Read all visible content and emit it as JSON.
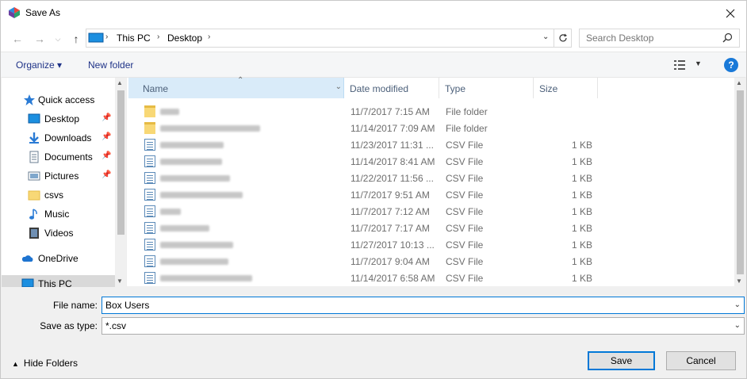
{
  "window": {
    "title": "Save As"
  },
  "address": {
    "crumbs": [
      "This PC",
      "Desktop"
    ]
  },
  "search": {
    "placeholder": "Search Desktop"
  },
  "toolbar": {
    "organize": "Organize ▾",
    "new_folder": "New folder",
    "help": "?"
  },
  "nav": {
    "items": [
      {
        "label": "Quick access",
        "icon": "star-icon"
      },
      {
        "label": "Desktop",
        "icon": "desktop-icon",
        "pinned": true
      },
      {
        "label": "Downloads",
        "icon": "download-icon",
        "pinned": true
      },
      {
        "label": "Documents",
        "icon": "documents-icon",
        "pinned": true
      },
      {
        "label": "Pictures",
        "icon": "pictures-icon",
        "pinned": true
      },
      {
        "label": "csvs",
        "icon": "folder-icon"
      },
      {
        "label": "Music",
        "icon": "music-icon"
      },
      {
        "label": "Videos",
        "icon": "video-icon"
      },
      {
        "label": "OneDrive",
        "icon": "cloud-icon"
      },
      {
        "label": "This PC",
        "icon": "pc-icon",
        "selected": true
      }
    ]
  },
  "columns": {
    "name": "Name",
    "date": "Date modified",
    "type": "Type",
    "size": "Size"
  },
  "files": [
    {
      "date": "11/7/2017 7:15 AM",
      "type": "File folder",
      "size": ""
    },
    {
      "date": "11/14/2017 7:09 AM",
      "type": "File folder",
      "size": ""
    },
    {
      "date": "11/23/2017 11:31 ...",
      "type": "CSV File",
      "size": "1 KB"
    },
    {
      "date": "11/14/2017 8:41 AM",
      "type": "CSV File",
      "size": "1 KB"
    },
    {
      "date": "11/22/2017 11:56 ...",
      "type": "CSV File",
      "size": "1 KB"
    },
    {
      "date": "11/7/2017 9:51 AM",
      "type": "CSV File",
      "size": "1 KB"
    },
    {
      "date": "11/7/2017 7:12 AM",
      "type": "CSV File",
      "size": "1 KB"
    },
    {
      "date": "11/7/2017 7:17 AM",
      "type": "CSV File",
      "size": "1 KB"
    },
    {
      "date": "11/27/2017 10:13 ...",
      "type": "CSV File",
      "size": "1 KB"
    },
    {
      "date": "11/7/2017 9:04 AM",
      "type": "CSV File",
      "size": "1 KB"
    },
    {
      "date": "11/14/2017 6:58 AM",
      "type": "CSV File",
      "size": "1 KB"
    }
  ],
  "form": {
    "file_name_label": "File name:",
    "file_name_value": "Box Users",
    "save_type_label": "Save as type:",
    "save_type_value": "*.csv"
  },
  "buttons": {
    "save": "Save",
    "cancel": "Cancel",
    "hide_folders": "Hide Folders"
  },
  "colors": {
    "accent": "#0078d7",
    "header_selected": "#d9ebf9",
    "link": "#1e3287"
  }
}
